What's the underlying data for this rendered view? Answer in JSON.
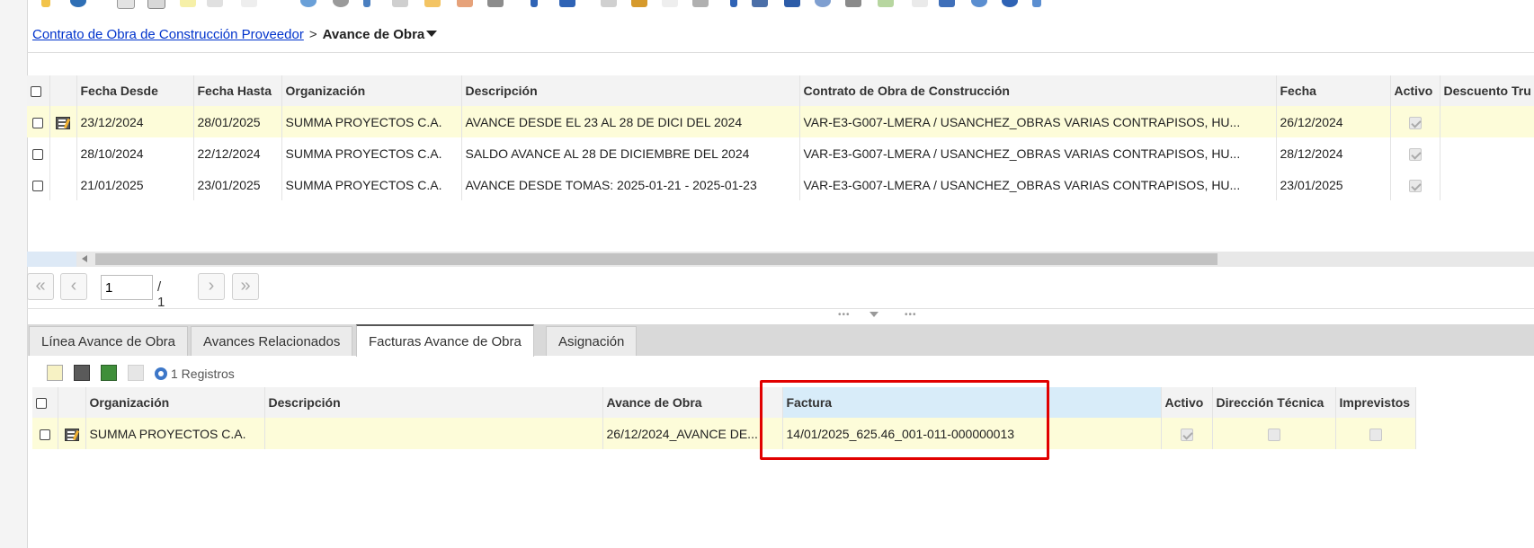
{
  "breadcrumb": {
    "parent_link": "Contrato de Obra de Construcción Proveedor",
    "separator": ">",
    "current": "Avance de Obra"
  },
  "main_grid": {
    "columns": [
      "Fecha Desde",
      "Fecha Hasta",
      "Organización",
      "Descripción",
      "Contrato de Obra de Construcción",
      "Fecha",
      "Activo",
      "Descuento Tru"
    ],
    "rows": [
      {
        "fecha_desde": "23/12/2024",
        "fecha_hasta": "28/01/2025",
        "organizacion": "SUMMA PROYECTOS C.A.",
        "descripcion": "AVANCE DESDE EL 23 AL 28 DE DICI DEL 2024",
        "contrato": "VAR-E3-G007-LMERA / USANCHEZ_OBRAS VARIAS CONTRAPISOS, HU...",
        "fecha": "26/12/2024",
        "activo": true
      },
      {
        "fecha_desde": "28/10/2024",
        "fecha_hasta": "22/12/2024",
        "organizacion": "SUMMA PROYECTOS C.A.",
        "descripcion": "SALDO AVANCE AL 28 DE DICIEMBRE DEL 2024",
        "contrato": "VAR-E3-G007-LMERA / USANCHEZ_OBRAS VARIAS CONTRAPISOS, HU...",
        "fecha": "28/12/2024",
        "activo": true
      },
      {
        "fecha_desde": "21/01/2025",
        "fecha_hasta": "23/01/2025",
        "organizacion": "SUMMA PROYECTOS C.A.",
        "descripcion": "AVANCE DESDE TOMAS: 2025-01-21 - 2025-01-23",
        "contrato": "VAR-E3-G007-LMERA / USANCHEZ_OBRAS VARIAS CONTRAPISOS, HU...",
        "fecha": "23/01/2025",
        "activo": true
      }
    ]
  },
  "pager": {
    "first": "«",
    "prev": "‹",
    "page_value": "1",
    "total": "/ 1",
    "next": "›",
    "last": "»"
  },
  "tabs": [
    "Línea Avance de Obra",
    "Avances Relacionados",
    "Facturas Avance de Obra",
    "Asignación"
  ],
  "detail": {
    "records": "1 Registros",
    "columns": [
      "Organización",
      "Descripción",
      "Avance de Obra",
      "Factura",
      "Activo",
      "Dirección Técnica",
      "Imprevistos"
    ],
    "rows": [
      {
        "organizacion": "SUMMA PROYECTOS C.A.",
        "descripcion": "",
        "avance": "26/12/2024_AVANCE DE...",
        "factura": "14/01/2025_625.46_001-011-000000013",
        "activo": true,
        "direccion_tecnica": false,
        "imprevistos": false
      }
    ]
  },
  "colors": {
    "selected_row": "#fdfcd9",
    "link": "#0033cc",
    "highlight_box": "#e10000",
    "factura_header": "#d8ecf9"
  }
}
